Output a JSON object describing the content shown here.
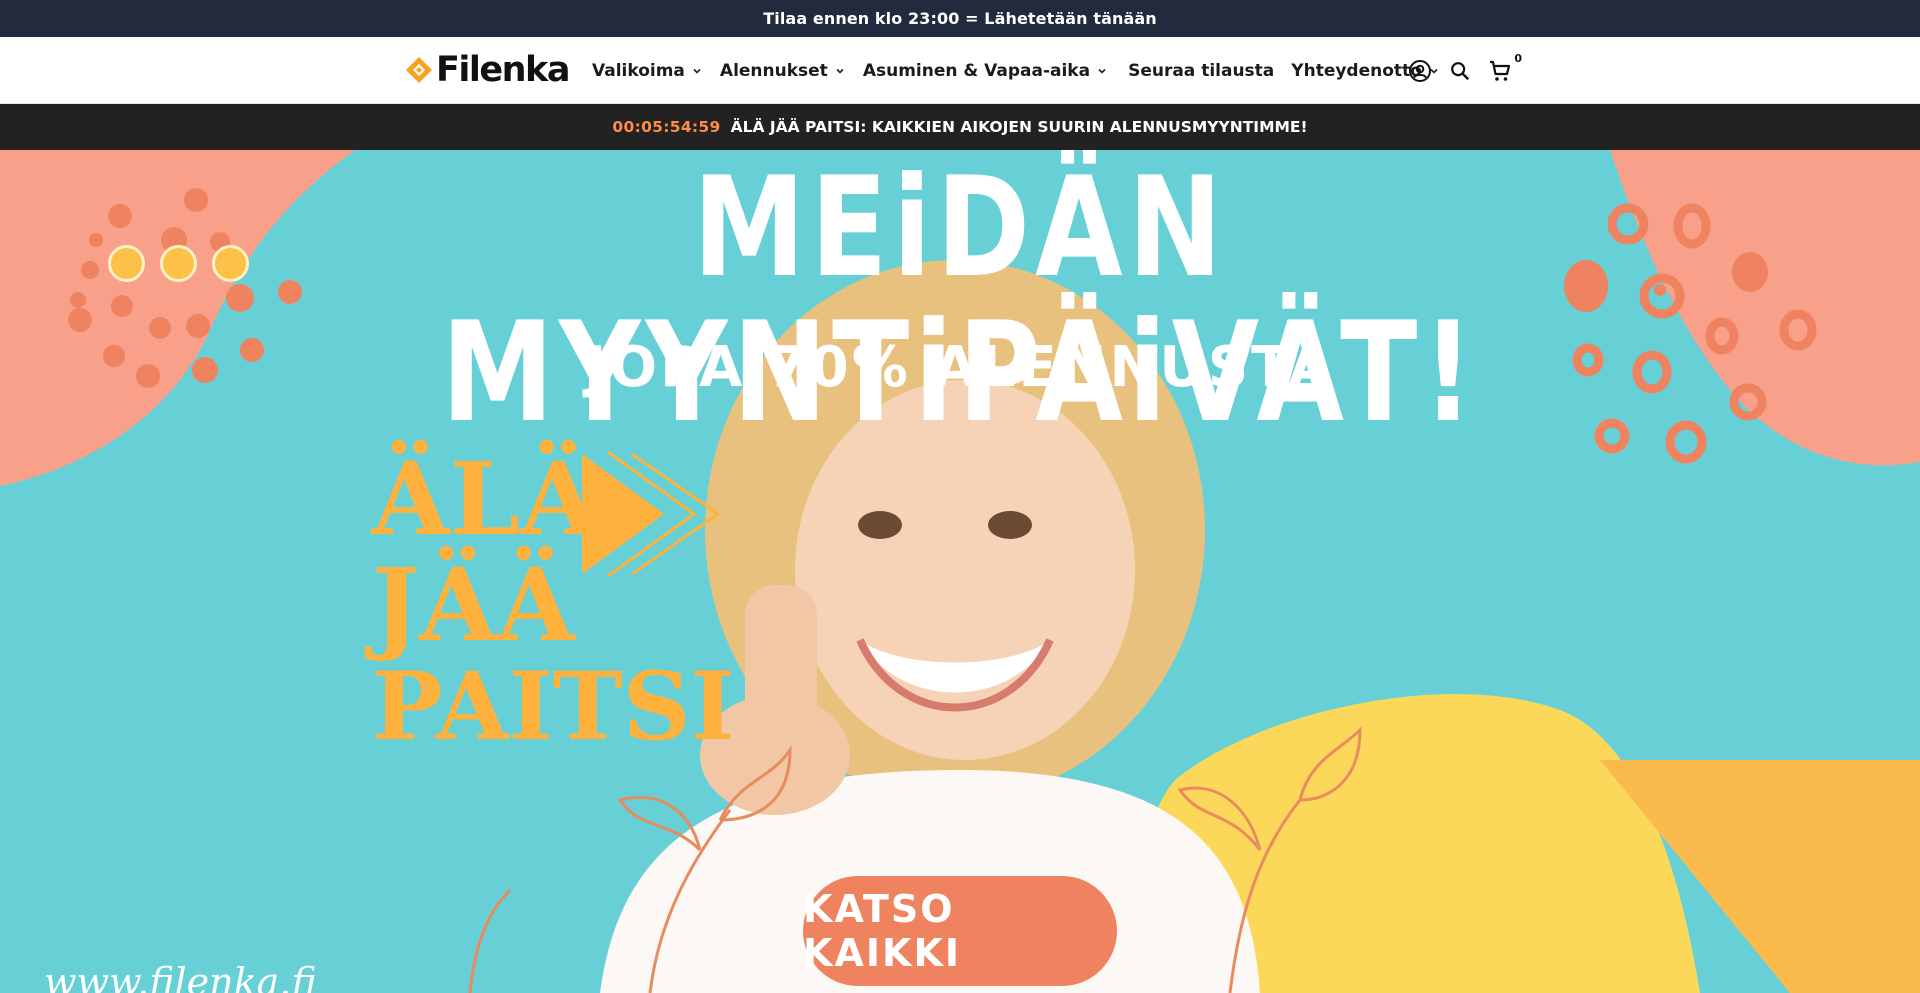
{
  "announcement": {
    "text": "Tilaa ennen klo 23:00 = Lähetetään tänään"
  },
  "header": {
    "logo_text": "Filenka",
    "nav": [
      {
        "label": "Valikoima",
        "has_dropdown": true
      },
      {
        "label": "Alennukset",
        "has_dropdown": true
      },
      {
        "label": "Asuminen & Vapaa-aika",
        "has_dropdown": true
      },
      {
        "label": "Seuraa tilausta",
        "has_dropdown": false
      },
      {
        "label": "Yhteydenotto",
        "has_dropdown": true
      }
    ],
    "icons": {
      "account": "account-icon",
      "search": "search-icon",
      "cart": "cart-icon"
    },
    "cart_count": "0"
  },
  "promo": {
    "timer": "00:05:54:59",
    "message": "ÄLÄ JÄÄ PAITSI: KAIKKIEN AIKOJEN SUURIN ALENNUSMYYNTIMME!"
  },
  "hero": {
    "title": "MEiDÄN MYYNTiPÄiVÄT!",
    "subtitle": "JOPA 70% ALENNUSTA",
    "slogan": [
      "ÄLÄ",
      "JÄÄ",
      "PAITSI"
    ],
    "cta_label": "KATSO KAIKKI",
    "website": "www.filenka.fi",
    "slide_count": 3
  },
  "colors": {
    "announcement_bg": "#222b3d",
    "promo_bg": "#222222",
    "timer": "#ff8c45",
    "hero_bg": "#66d0d6",
    "accent_orange": "#ef8360",
    "accent_yellow": "#ffb13d",
    "logo_diamond": "#f6a21e"
  }
}
